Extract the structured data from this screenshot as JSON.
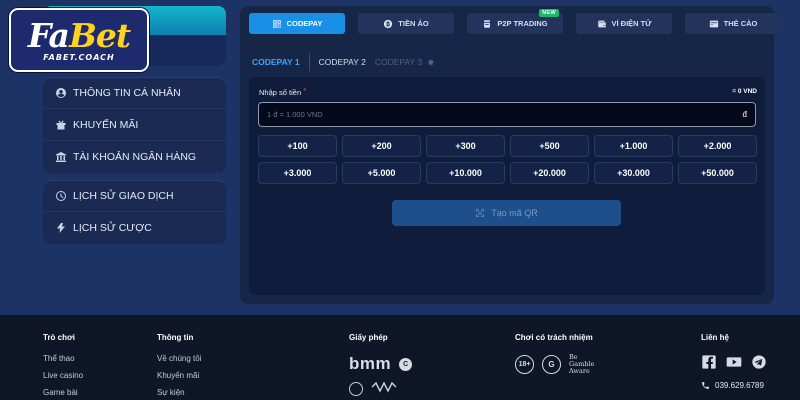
{
  "brand": {
    "logo_main_a": "Fa",
    "logo_main_b": "Bet",
    "logo_sub": "FABET.COACH"
  },
  "sidebar": {
    "group1": [
      {
        "label": "THÔNG TIN CÁ NHÂN",
        "icon": "user-icon"
      },
      {
        "label": "KHUYẾN MÃI",
        "icon": "promo-icon"
      },
      {
        "label": "TÀI KHOẢN NGÂN HÀNG",
        "icon": "bank-icon"
      }
    ],
    "group2": [
      {
        "label": "LỊCH SỬ GIAO DỊCH",
        "icon": "history-icon"
      },
      {
        "label": "LỊCH SỬ CƯỢC",
        "icon": "bet-history-icon"
      }
    ]
  },
  "payment_methods": [
    {
      "label": "CODEPAY",
      "icon": "codepay-icon",
      "active": true
    },
    {
      "label": "TIỀN ẢO",
      "icon": "crypto-icon",
      "active": false
    },
    {
      "label": "P2P TRADING",
      "icon": "p2p-icon",
      "active": false,
      "badge": "NEW"
    },
    {
      "label": "VÍ ĐIỆN TỬ",
      "icon": "wallet-icon",
      "active": false
    },
    {
      "label": "THẺ CÀO",
      "icon": "card-icon",
      "active": false
    }
  ],
  "sub_tabs": {
    "tab1": "CODEPAY 1",
    "tab2": "CODEPAY 2",
    "tab3": "CODEPAY 3"
  },
  "amount": {
    "label": "Nhập số tiền",
    "required_mark": "*",
    "total": "= 0 VND",
    "placeholder": "1 đ = 1.000 VND",
    "value": "",
    "currency": "đ"
  },
  "quick_amounts": [
    "+100",
    "+200",
    "+300",
    "+500",
    "+1.000",
    "+2.000",
    "+3.000",
    "+5.000",
    "+10.000",
    "+20.000",
    "+30.000",
    "+50.000"
  ],
  "qr_button": {
    "label": "Tạo mã QR"
  },
  "footer": {
    "games": {
      "title": "Trò chơi",
      "links": [
        "Thể thao",
        "Live casino",
        "Game bài"
      ]
    },
    "info": {
      "title": "Thông tin",
      "links": [
        "Về chúng tôi",
        "Khuyến mãi",
        "Sự kiện"
      ]
    },
    "license": {
      "title": "Giấy phép",
      "bmm": "bmm",
      "badge": "C"
    },
    "responsible": {
      "title": "Chơi có trách nhiệm",
      "age": "18+",
      "gc": "G",
      "aware_line1": "Be",
      "aware_line2": "Gamble",
      "aware_line3": "Aware"
    },
    "contact": {
      "title": "Liên hệ",
      "phone": "039.629.6789"
    }
  },
  "colors": {
    "accent": "#1a8fe6",
    "background": "#1e3365",
    "panel": "#162647",
    "footer": "#0e1628"
  }
}
